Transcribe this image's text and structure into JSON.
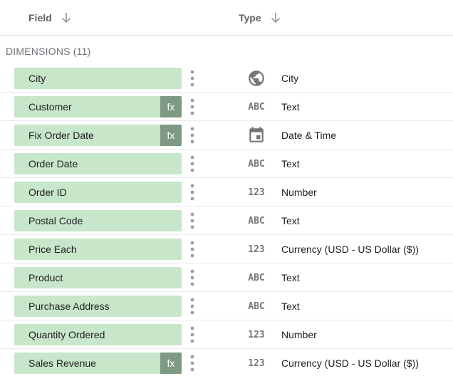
{
  "header": {
    "field_label": "Field",
    "type_label": "Type"
  },
  "section": {
    "title": "DIMENSIONS (11)"
  },
  "rows": [
    {
      "field": "City",
      "calculated": false,
      "type_icon": "globe-icon",
      "type": "City"
    },
    {
      "field": "Customer",
      "calculated": true,
      "fx_label": "fx",
      "type_icon": "abc-icon",
      "type_icon_text": "ABC",
      "type": "Text"
    },
    {
      "field": "Fix Order Date",
      "calculated": true,
      "fx_label": "fx",
      "type_icon": "calendar-icon",
      "type": "Date & Time"
    },
    {
      "field": "Order Date",
      "calculated": false,
      "type_icon": "abc-icon",
      "type_icon_text": "ABC",
      "type": "Text"
    },
    {
      "field": "Order ID",
      "calculated": false,
      "type_icon": "number-icon",
      "type_icon_text": "123",
      "type": "Number"
    },
    {
      "field": "Postal Code",
      "calculated": false,
      "type_icon": "abc-icon",
      "type_icon_text": "ABC",
      "type": "Text"
    },
    {
      "field": "Price Each",
      "calculated": false,
      "type_icon": "number-icon",
      "type_icon_text": "123",
      "type": "Currency (USD - US Dollar ($))"
    },
    {
      "field": "Product",
      "calculated": false,
      "type_icon": "abc-icon",
      "type_icon_text": "ABC",
      "type": "Text"
    },
    {
      "field": "Purchase Address",
      "calculated": false,
      "type_icon": "abc-icon",
      "type_icon_text": "ABC",
      "type": "Text"
    },
    {
      "field": "Quantity Ordered",
      "calculated": false,
      "type_icon": "number-icon",
      "type_icon_text": "123",
      "type": "Number"
    },
    {
      "field": "Sales Revenue",
      "calculated": true,
      "fx_label": "fx",
      "type_icon": "number-icon",
      "type_icon_text": "123",
      "type": "Currency (USD - US Dollar ($))"
    }
  ],
  "colors": {
    "chip": "#c8e6c9",
    "fx_badge": "#7f9a84",
    "icon": "#757575"
  }
}
